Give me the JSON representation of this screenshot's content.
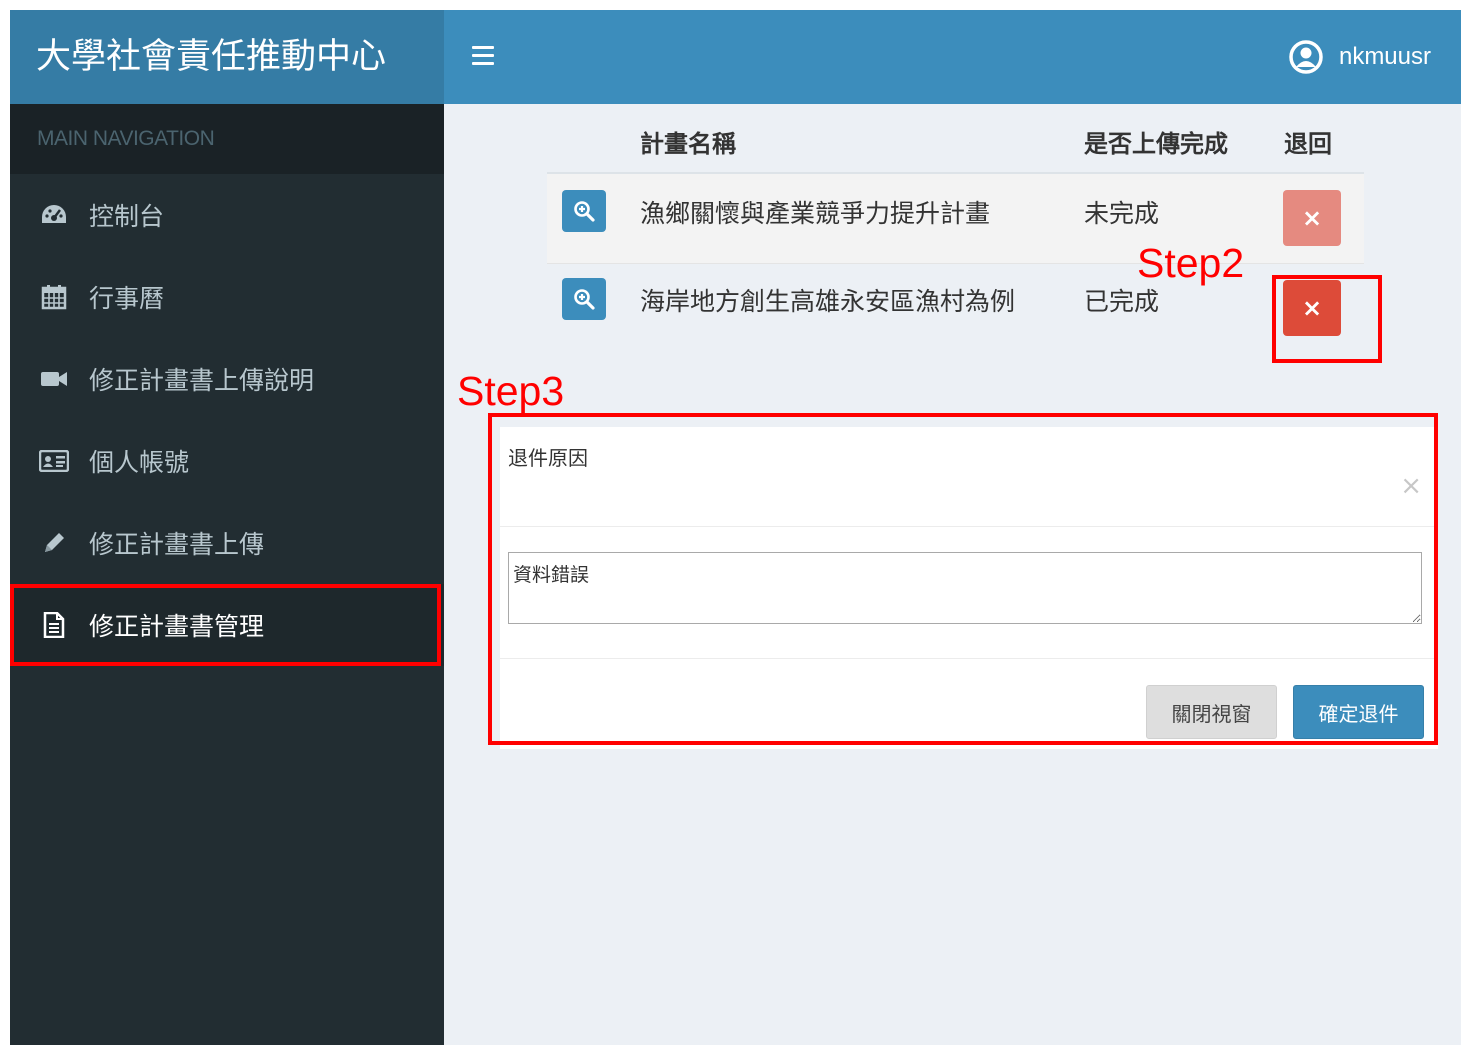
{
  "app": {
    "logo_text": "大學社會責任推動中心",
    "user_name": "nkmuusr"
  },
  "sidebar": {
    "header": "MAIN NAVIGATION",
    "items": [
      {
        "label": "控制台",
        "icon": "dashboard-icon"
      },
      {
        "label": "行事曆",
        "icon": "calendar-icon"
      },
      {
        "label": "修正計畫書上傳說明",
        "icon": "video-camera-icon"
      },
      {
        "label": "個人帳號",
        "icon": "id-card-icon"
      },
      {
        "label": "修正計畫書上傳",
        "icon": "pencil-icon"
      },
      {
        "label": "修正計畫書管理",
        "icon": "file-text-icon",
        "active": true
      }
    ]
  },
  "table": {
    "headers": {
      "name": "計畫名稱",
      "status": "是否上傳完成",
      "return": "退回"
    },
    "rows": [
      {
        "name": "漁鄉關懷與產業競爭力提升計畫",
        "status": "未完成",
        "return_icon": "×"
      },
      {
        "name": "海岸地方創生高雄永安區漁村為例",
        "status": "已完成",
        "return_icon": "×"
      }
    ]
  },
  "annotations": {
    "step2": "Step2",
    "step3": "Step3",
    "annotation_color": "#ff0000"
  },
  "modal": {
    "title": "退件原因",
    "close_icon": "×",
    "reason_value": "資料錯誤",
    "close_button": "關閉視窗",
    "confirm_button": "確定退件"
  },
  "colors": {
    "header": "#3c8dbc",
    "logo_bg": "#357ca5",
    "sidebar": "#222d32",
    "danger": "#dd4b39",
    "danger_disabled": "#e58a80"
  }
}
